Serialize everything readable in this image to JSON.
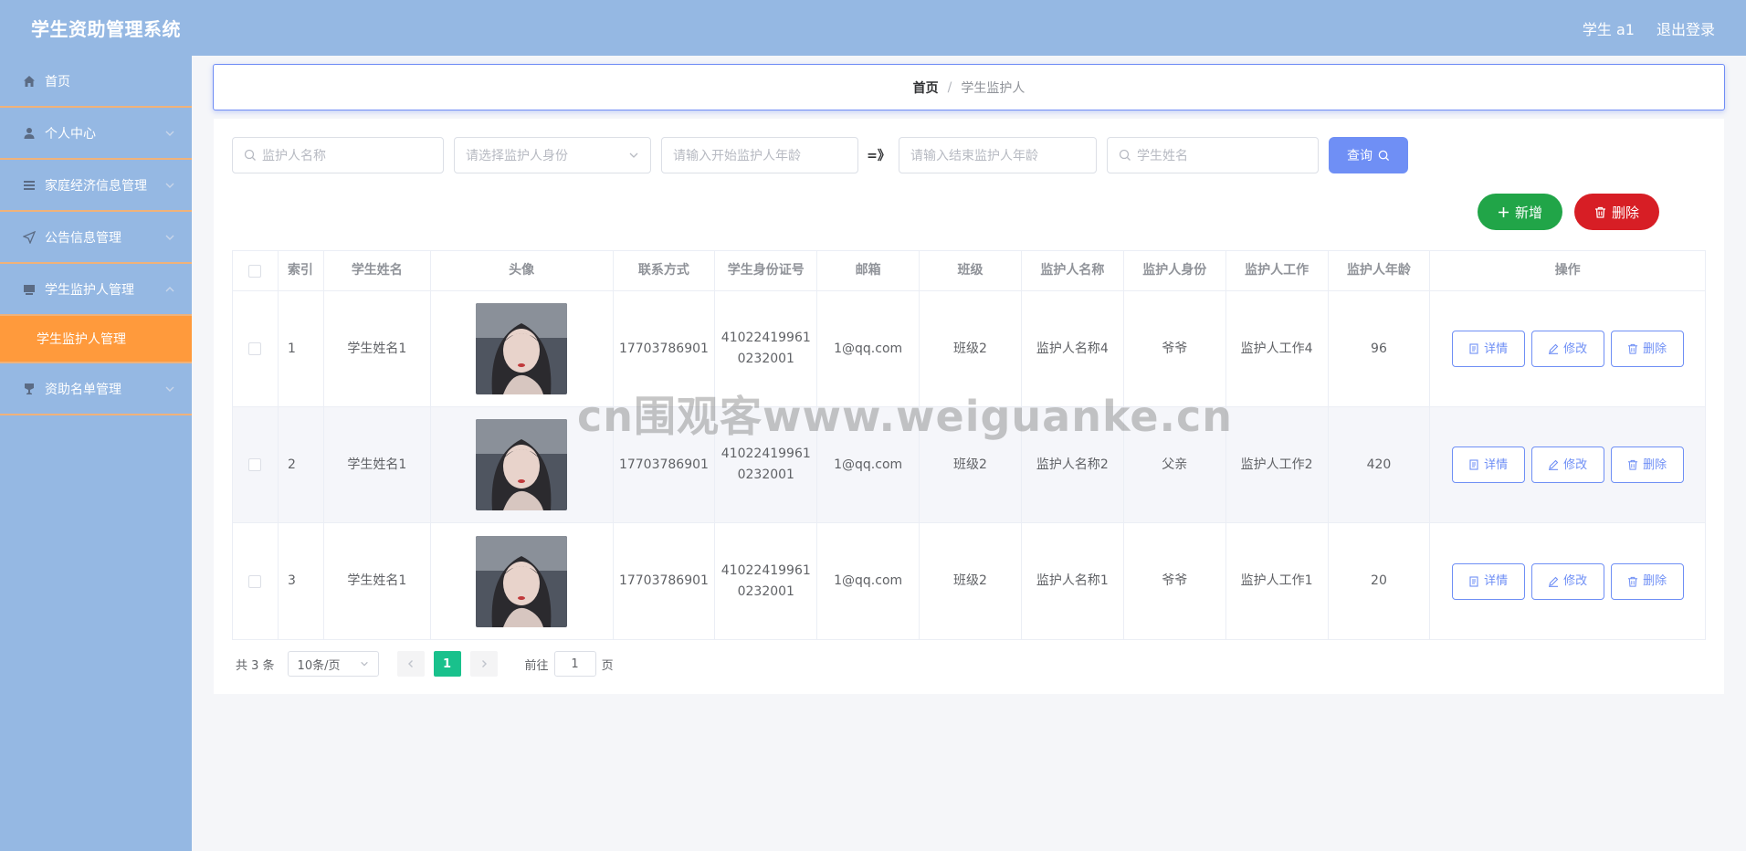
{
  "header": {
    "title": "学生资助管理系统",
    "user": "学生 a1",
    "logout": "退出登录"
  },
  "sidebar": {
    "items": [
      {
        "label": "首页",
        "icon": "home-icon"
      },
      {
        "label": "个人中心",
        "icon": "user-icon"
      },
      {
        "label": "家庭经济信息管理",
        "icon": "menu-icon"
      },
      {
        "label": "公告信息管理",
        "icon": "send-icon"
      },
      {
        "label": "学生监护人管理",
        "icon": "monitor-icon"
      },
      {
        "label": "资助名单管理",
        "icon": "goblet-icon"
      }
    ],
    "sub_active": "学生监护人管理"
  },
  "breadcrumb": {
    "home": "首页",
    "separator": "/",
    "current": "学生监护人"
  },
  "search": {
    "guardian_name_placeholder": "监护人名称",
    "identity_placeholder": "请选择监护人身份",
    "age_start_placeholder": "请输入开始监护人年龄",
    "range_separator": "=》",
    "age_end_placeholder": "请输入结束监护人年龄",
    "student_name_placeholder": "学生姓名",
    "query_label": "查询"
  },
  "actions": {
    "add_label": "新增",
    "delete_label": "删除"
  },
  "table": {
    "headers": [
      "索引",
      "学生姓名",
      "头像",
      "联系方式",
      "学生身份证号",
      "邮箱",
      "班级",
      "监护人名称",
      "监护人身份",
      "监护人工作",
      "监护人年龄",
      "操作"
    ],
    "rows": [
      {
        "index": "1",
        "student": "学生姓名1",
        "phone": "17703786901",
        "idcard_line1": "41022419961",
        "idcard_line2": "0232001",
        "email": "1@qq.com",
        "class": "班级2",
        "guardian": "监护人名称4",
        "identity": "爷爷",
        "job": "监护人工作4",
        "age": "96"
      },
      {
        "index": "2",
        "student": "学生姓名1",
        "phone": "17703786901",
        "idcard_line1": "41022419961",
        "idcard_line2": "0232001",
        "email": "1@qq.com",
        "class": "班级2",
        "guardian": "监护人名称2",
        "identity": "父亲",
        "job": "监护人工作2",
        "age": "420"
      },
      {
        "index": "3",
        "student": "学生姓名1",
        "phone": "17703786901",
        "idcard_line1": "41022419961",
        "idcard_line2": "0232001",
        "email": "1@qq.com",
        "class": "班级2",
        "guardian": "监护人名称1",
        "identity": "爷爷",
        "job": "监护人工作1",
        "age": "20"
      }
    ],
    "op_detail": "详情",
    "op_edit": "修改",
    "op_delete": "删除"
  },
  "pagination": {
    "total": "共 3 条",
    "page_size": "10条/页",
    "current_page": "1",
    "goto_label": "前往",
    "goto_value": "1",
    "page_unit": "页"
  },
  "watermark": "cn围观客www.weiguanke.cn",
  "colors": {
    "sidebar_bg": "#95b8e3",
    "active_submenu": "#ff9a3c",
    "primary": "#6f8ff5",
    "add_button": "#21a548",
    "delete_button": "#d71e25",
    "page_active": "#19c18c"
  }
}
